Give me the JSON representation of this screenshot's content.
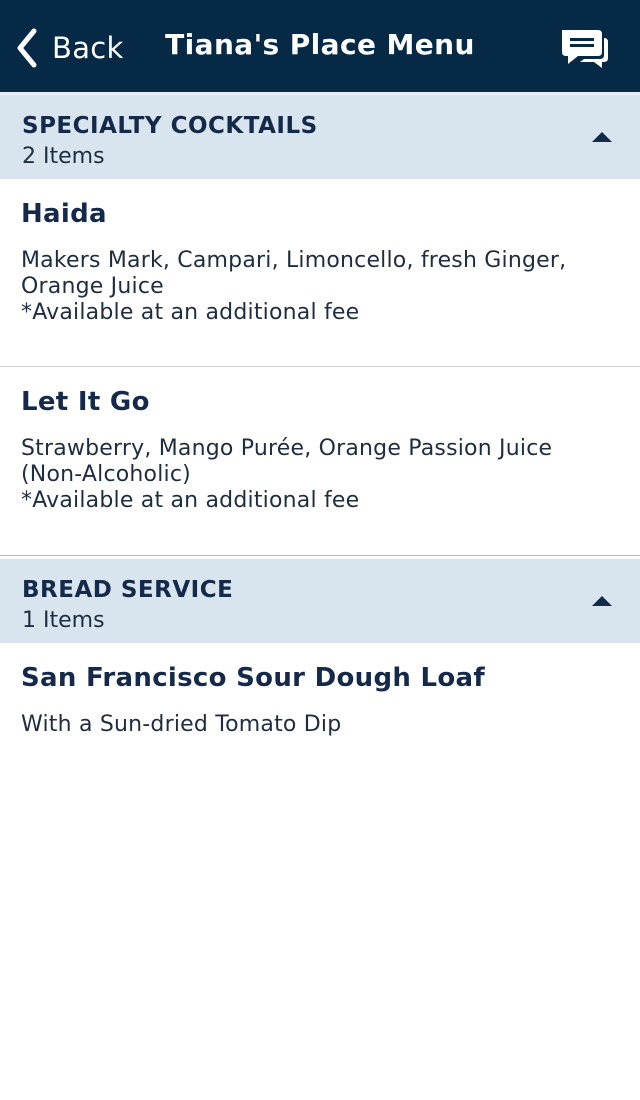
{
  "nav": {
    "back_label": "Back",
    "title": "Tiana's Place Menu",
    "icons": [
      "chevron-left-icon",
      "chat-bubbles-icon"
    ]
  },
  "colors": {
    "nav_background": "#062a45",
    "section_background": "#d8e5ee",
    "text_primary": "#15294a"
  },
  "sections": [
    {
      "title": "SPECIALTY COCKTAILS",
      "count": "2 Items",
      "items": [
        {
          "name": "Haida",
          "description_lines": [
            "Makers Mark, Campari, Limoncello, fresh Ginger,",
            "Orange Juice"
          ],
          "fee": "*Available at an additional fee"
        },
        {
          "name": "Let It Go",
          "description_lines": [
            "Strawberry, Mango Purée, Orange Passion Juice",
            "(Non-Alcoholic)"
          ],
          "fee": "*Available at an additional fee"
        }
      ]
    },
    {
      "title": "BREAD SERVICE",
      "count": "1 Items",
      "items": [
        {
          "name": "San Francisco Sour Dough Loaf",
          "description_lines": [
            "With a Sun-dried Tomato Dip"
          ]
        }
      ]
    }
  ]
}
